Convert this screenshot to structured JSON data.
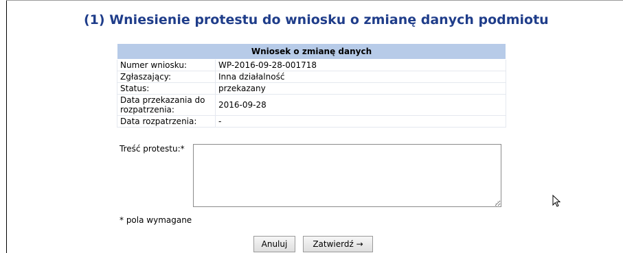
{
  "title": "(1) Wniesienie protestu do wniosku o zmianę danych podmiotu",
  "info_table": {
    "header": "Wniosek o zmianę danych",
    "rows": [
      {
        "label": "Numer wniosku:",
        "value": "WP-2016-09-28-001718"
      },
      {
        "label": "Zgłaszający:",
        "value": "Inna działalność"
      },
      {
        "label": "Status:",
        "value": "przekazany"
      },
      {
        "label": "Data przekazania do rozpatrzenia:",
        "value": "2016-09-28"
      },
      {
        "label": "Data rozpatrzenia:",
        "value": "-"
      }
    ]
  },
  "form": {
    "protest_label": "Treść protestu:*",
    "protest_value": "",
    "required_note": "* pola wymagane"
  },
  "buttons": {
    "cancel": "Anuluj",
    "submit": "Zatwierdź →"
  },
  "colors": {
    "title": "#1f3d8a",
    "table_header_bg": "#b7cbe8"
  }
}
